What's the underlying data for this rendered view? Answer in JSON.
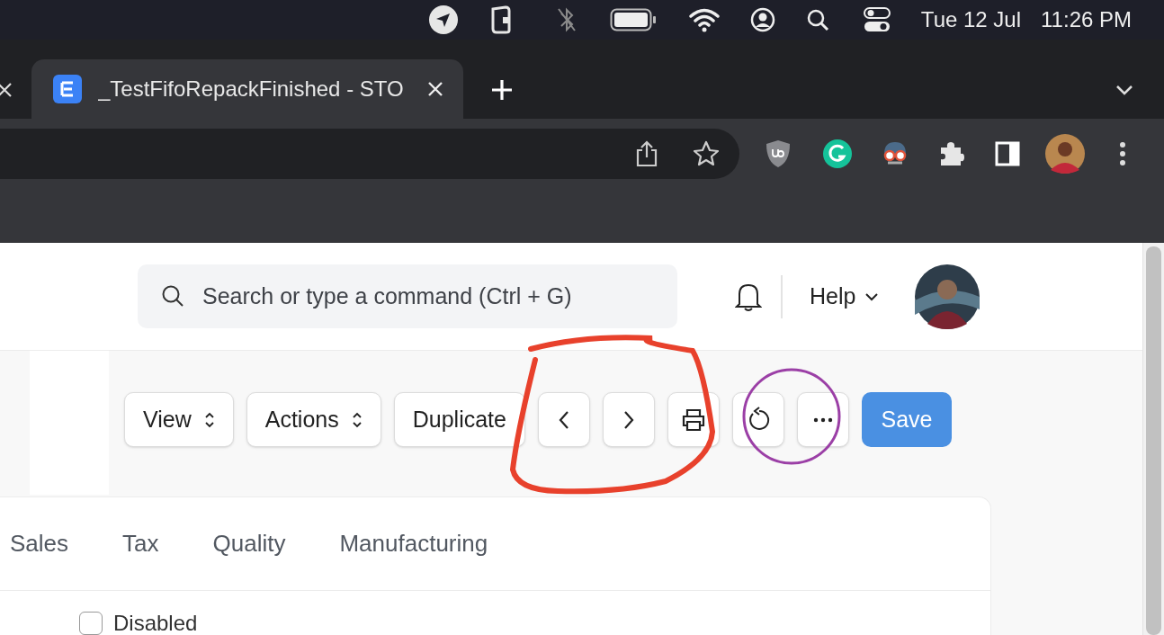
{
  "menu_bar": {
    "date": "Tue 12 Jul",
    "time": "11:26 PM"
  },
  "browser": {
    "tabs": [
      {
        "title": "_TestFifoRepackFinished - STO",
        "selected": true
      }
    ]
  },
  "page": {
    "search": {
      "placeholder": "Search or type a command (Ctrl + G)"
    },
    "help": "Help",
    "toolbar": [
      {
        "kind": "dropdown",
        "label": "View"
      },
      {
        "kind": "dropdown",
        "label": "Actions"
      },
      {
        "kind": "text",
        "label": "Duplicate"
      },
      {
        "kind": "prev"
      },
      {
        "kind": "next"
      },
      {
        "kind": "print"
      },
      {
        "kind": "reload"
      },
      {
        "kind": "more"
      },
      {
        "kind": "primary",
        "label": "Save"
      }
    ],
    "form_tabs": [
      {
        "label": "Sales",
        "selected": false
      },
      {
        "label": "Tax",
        "selected": false
      },
      {
        "label": "Quality",
        "selected": false
      },
      {
        "label": "Manufacturing",
        "selected": false
      }
    ],
    "checkbox": {
      "label": "Disabled",
      "checked": false
    }
  },
  "annotations": [
    {
      "kind": "scribble",
      "color": "#e8412c"
    },
    {
      "kind": "circle",
      "color": "#9b3fa6"
    }
  ]
}
